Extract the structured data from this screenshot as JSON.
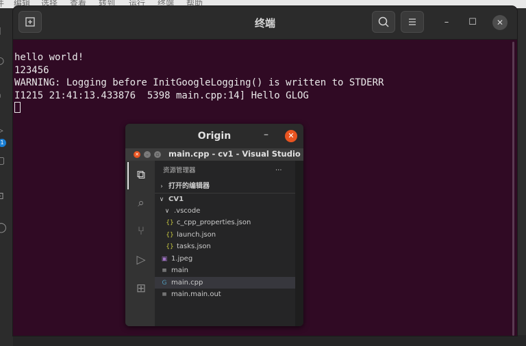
{
  "background_menu": [
    "件",
    "编辑",
    "选择",
    "查看",
    "转到",
    "运行",
    "终端",
    "帮助"
  ],
  "background_activity_badge": "1",
  "terminal": {
    "title": "终端",
    "lines": [
      "hello world!",
      "123456",
      "WARNING: Logging before InitGoogleLogging() is written to STDERR",
      "I1215 21:41:13.433876  5398 main.cpp:14] Hello GLOG"
    ],
    "colors": {
      "background": "#300a24",
      "text": "#eaeaea",
      "header": "#2b2b2b"
    },
    "icons": {
      "new_tab": "new-tab-icon",
      "search": "search-icon",
      "menu": "hamburger-menu-icon"
    }
  },
  "origin_window": {
    "title": "Origin",
    "close_color": "#e95420",
    "vscode": {
      "title": "main.cpp - cv1 - Visual Studio Code",
      "explorer_title": "资源管理器",
      "explorer_more": "···",
      "open_editors": "打开的编辑器",
      "folder": "CV1",
      "tree": [
        {
          "label": ".vscode",
          "icon": "∨",
          "indent": 1
        },
        {
          "label": "c_cpp_properties.json",
          "icon": "{}",
          "indent": 2
        },
        {
          "label": "launch.json",
          "icon": "{}",
          "indent": 2
        },
        {
          "label": "tasks.json",
          "icon": "{}",
          "indent": 2
        },
        {
          "label": "1.jpeg",
          "icon": "▣",
          "indent": 1
        },
        {
          "label": "main",
          "icon": "≡",
          "indent": 1
        },
        {
          "label": "main.cpp",
          "icon": "G",
          "indent": 1,
          "selected": true
        },
        {
          "label": "main.main.out",
          "icon": "≡",
          "indent": 1
        }
      ]
    }
  }
}
